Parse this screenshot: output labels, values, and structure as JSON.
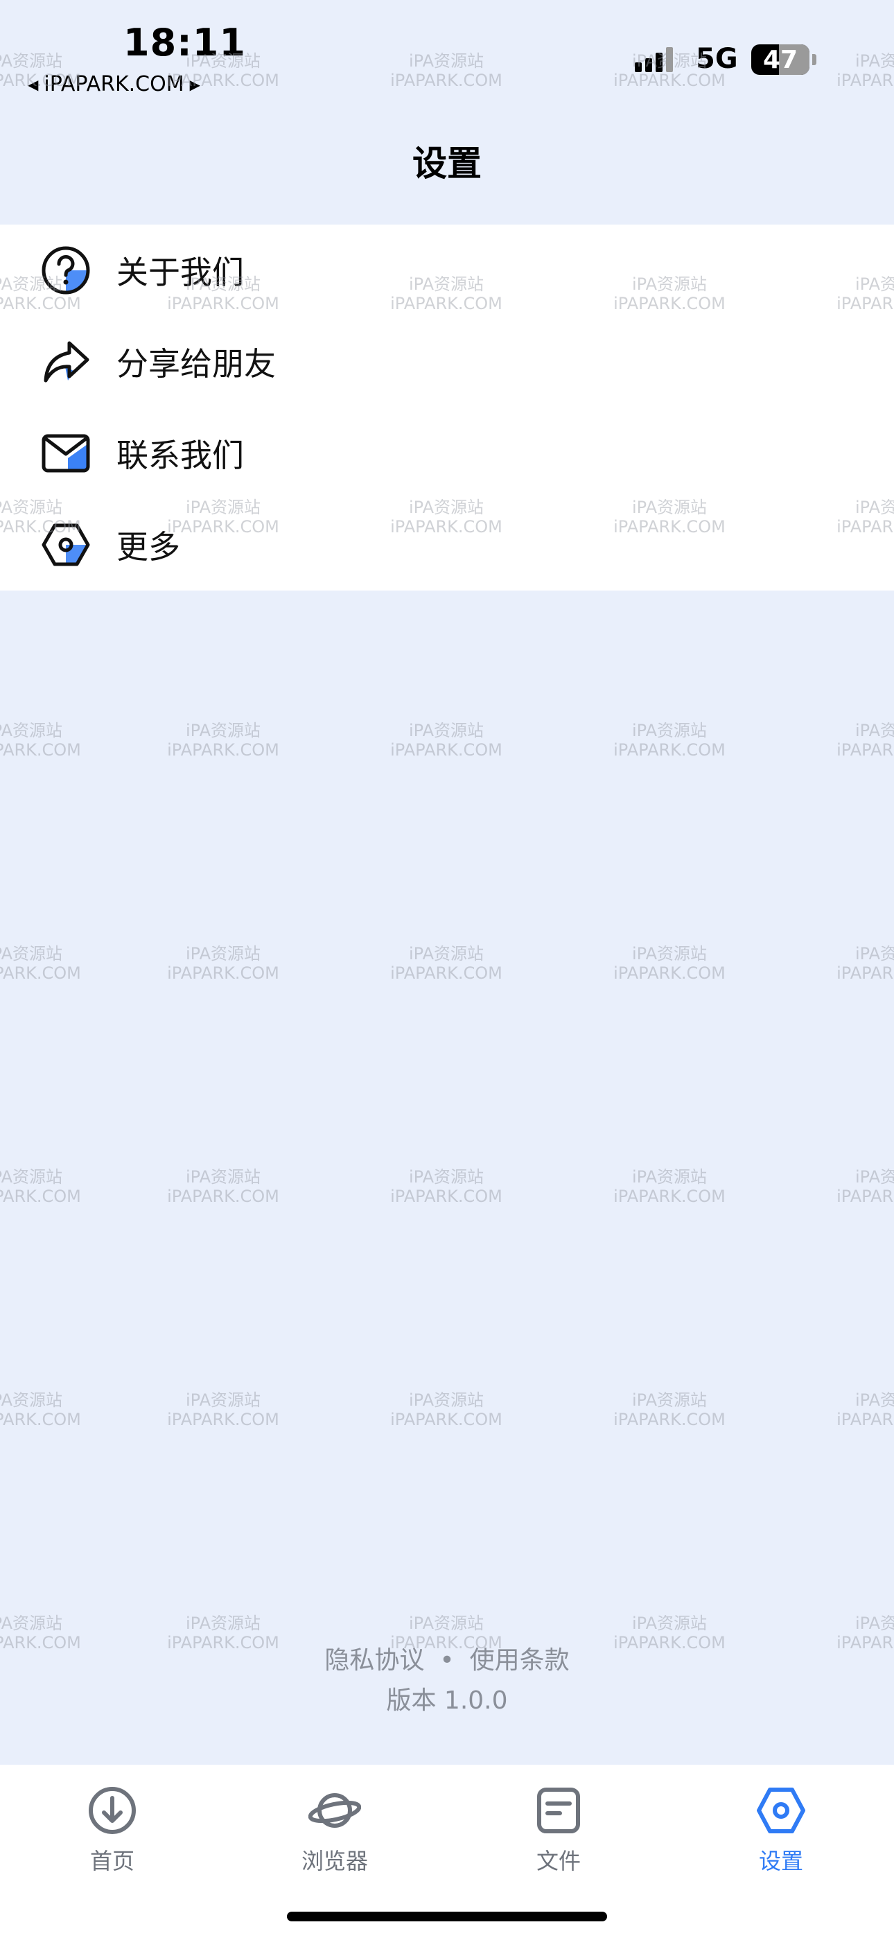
{
  "status_bar": {
    "time": "18:11",
    "carrier_link": "iPAPARK.COM",
    "network": "5G",
    "battery": "47",
    "battery_level_percent": 47
  },
  "header": {
    "title": "设置"
  },
  "menu": {
    "items": [
      {
        "label": "关于我们",
        "icon": "question-circle-icon"
      },
      {
        "label": "分享给朋友",
        "icon": "share-arrow-icon"
      },
      {
        "label": "联系我们",
        "icon": "mail-icon"
      },
      {
        "label": "更多",
        "icon": "hexagon-gear-icon"
      }
    ]
  },
  "footer": {
    "privacy": "隐私协议",
    "separator": "•",
    "terms": "使用条款",
    "version": "版本 1.0.0"
  },
  "tabbar": {
    "tabs": [
      {
        "label": "首页",
        "icon": "download-circle-icon",
        "active": false
      },
      {
        "label": "浏览器",
        "icon": "planet-icon",
        "active": false
      },
      {
        "label": "文件",
        "icon": "document-icon",
        "active": false
      },
      {
        "label": "设置",
        "icon": "hexagon-gear-icon",
        "active": true
      }
    ]
  },
  "watermark": {
    "line1": "iPA资源站",
    "line2": "iPAPARK.COM"
  },
  "colors": {
    "background": "#e9effb",
    "card": "#ffffff",
    "accent": "#2f7bf5",
    "muted_text": "#8a8f99"
  }
}
